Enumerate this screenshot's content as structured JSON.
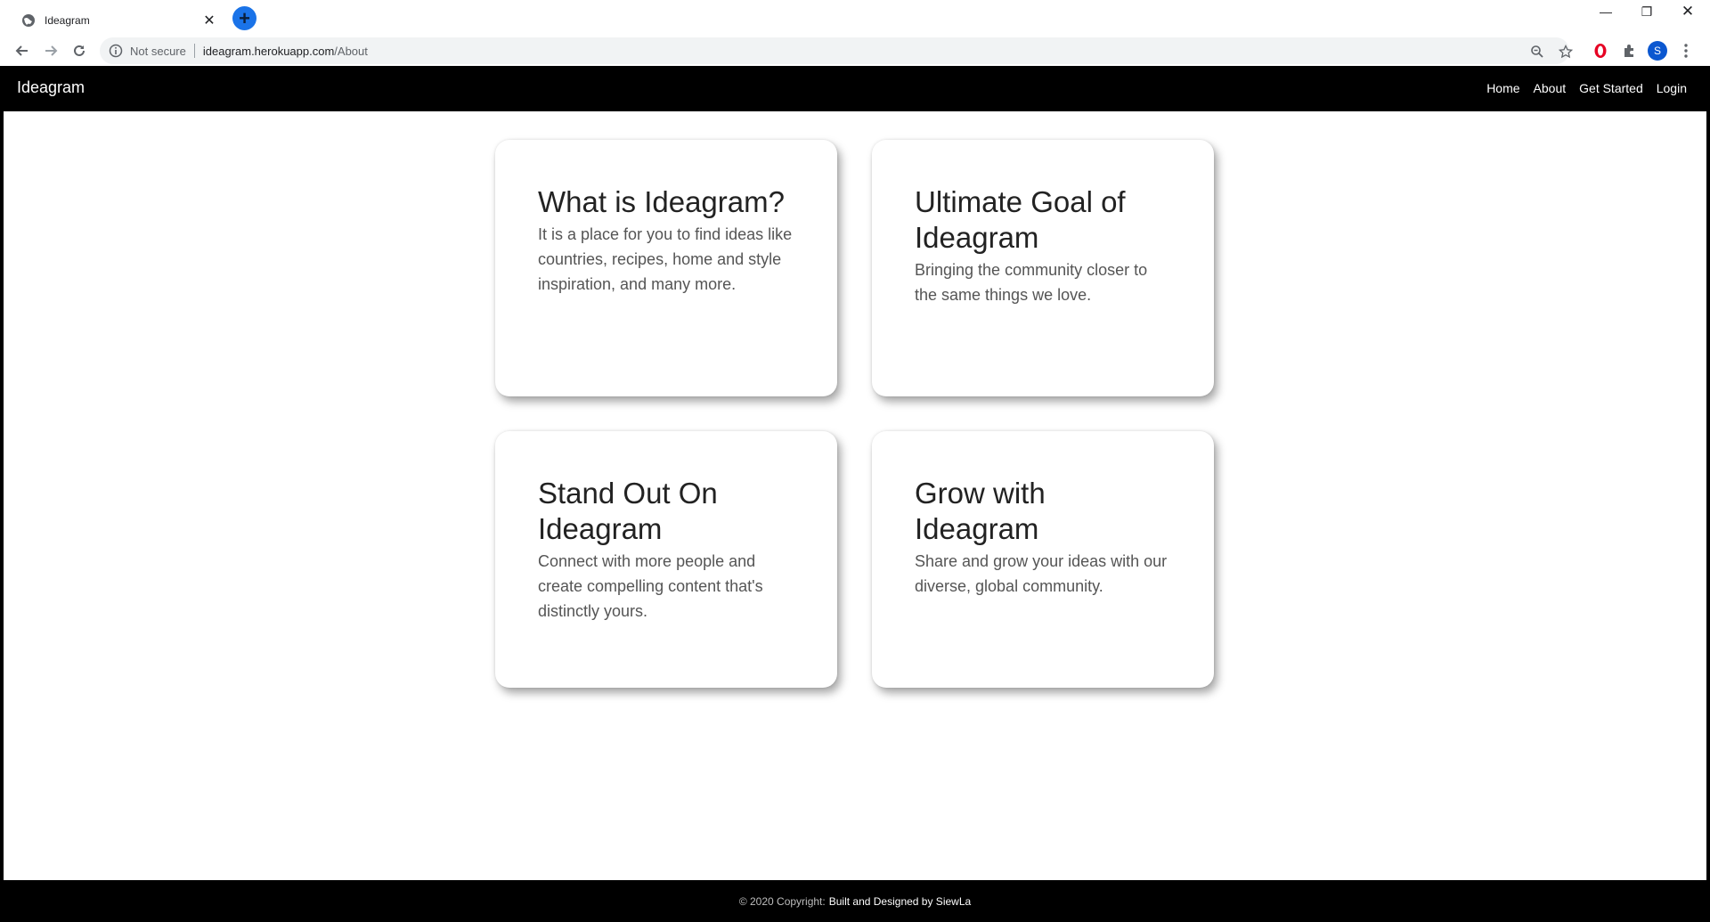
{
  "browser": {
    "tab_title": "Ideagram",
    "new_tab_symbol": "+",
    "security_label": "Not secure",
    "url_host": "ideagram.herokuapp.com",
    "url_path": "/About",
    "profile_initial": "S",
    "icons": [
      "globe-icon",
      "close-icon",
      "new-tab-icon",
      "back-icon",
      "forward-icon",
      "reload-icon",
      "info-icon",
      "zoom-icon",
      "star-icon",
      "opera-icon",
      "extensions-icon",
      "menu-icon",
      "minimize-icon",
      "maximize-icon"
    ]
  },
  "navbar": {
    "brand": "Ideagram",
    "links": [
      "Home",
      "About",
      "Get Started",
      "Login"
    ]
  },
  "cards": [
    {
      "title": "What is Ideagram?",
      "text": "It is a place for you to find ideas like countries, recipes, home and style inspiration, and many more."
    },
    {
      "title": "Ultimate Goal of Ideagram",
      "text": "Bringing the community closer to the same things we love."
    },
    {
      "title": "Stand Out On Ideagram",
      "text": "Connect with more people and create compelling content that's distinctly yours."
    },
    {
      "title": "Grow with Ideagram",
      "text": "Share and grow your ideas with our diverse, global community."
    }
  ],
  "footer": {
    "copyright": "© 2020 Copyright:",
    "credit": "Built and Designed by SiewLa"
  },
  "colors": {
    "navbar_bg": "#000000",
    "accent_new_tab": "#1a73e8",
    "opera_red": "#e60023"
  }
}
